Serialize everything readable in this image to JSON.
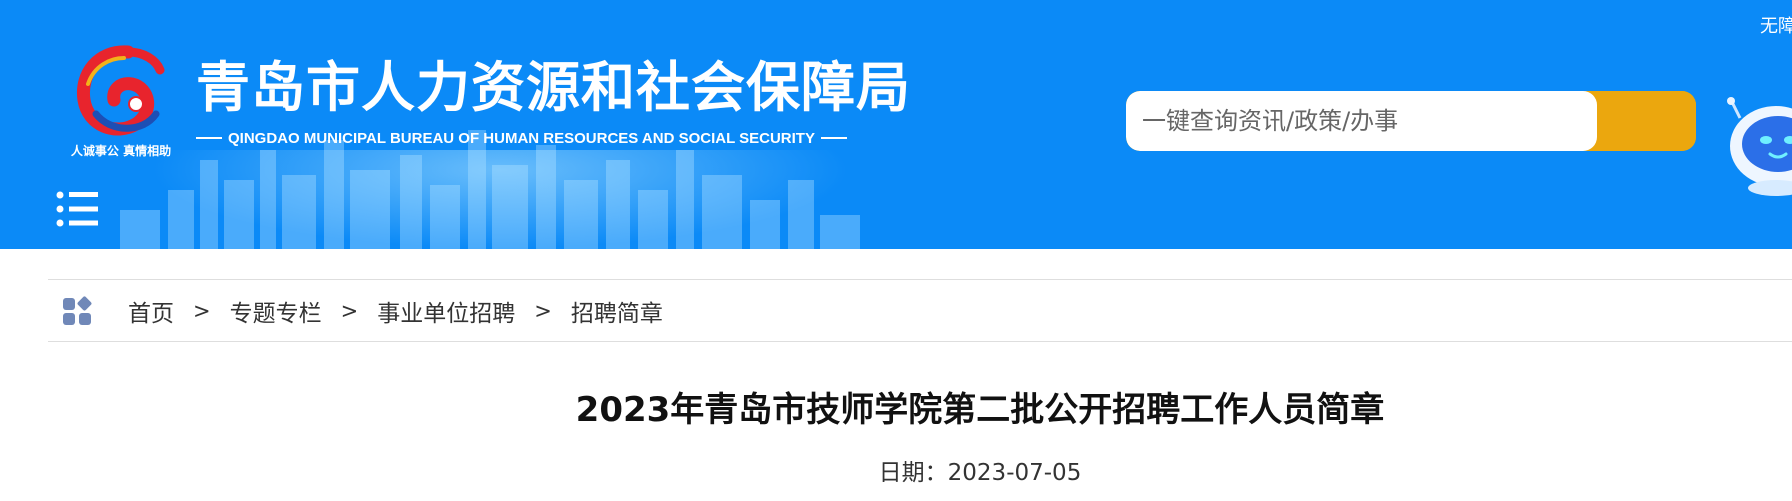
{
  "header": {
    "logo_slogan": "人诚事公 真情相助",
    "site_title": "青岛市人力资源和社会保障局",
    "site_subtitle": "QINGDAO MUNICIPAL BUREAU OF HUMAN RESOURCES AND SOCIAL SECURITY",
    "accessibility_label": "无障",
    "background_color": "#0b8af7"
  },
  "search": {
    "placeholder": "一键查询资讯/政策/办事",
    "button_color": "#eba70e"
  },
  "breadcrumb": {
    "items": [
      "首页",
      "专题专栏",
      "事业单位招聘",
      "招聘简章"
    ],
    "separator": ">"
  },
  "article": {
    "title": "2023年青岛市技师学院第二批公开招聘工作人员简章",
    "date_label": "日期：2023-07-05"
  },
  "icons": {
    "menu": "menu-icon",
    "search": "search-icon",
    "breadcrumb": "grid-apps-icon",
    "assistant": "robot-assistant-icon"
  }
}
